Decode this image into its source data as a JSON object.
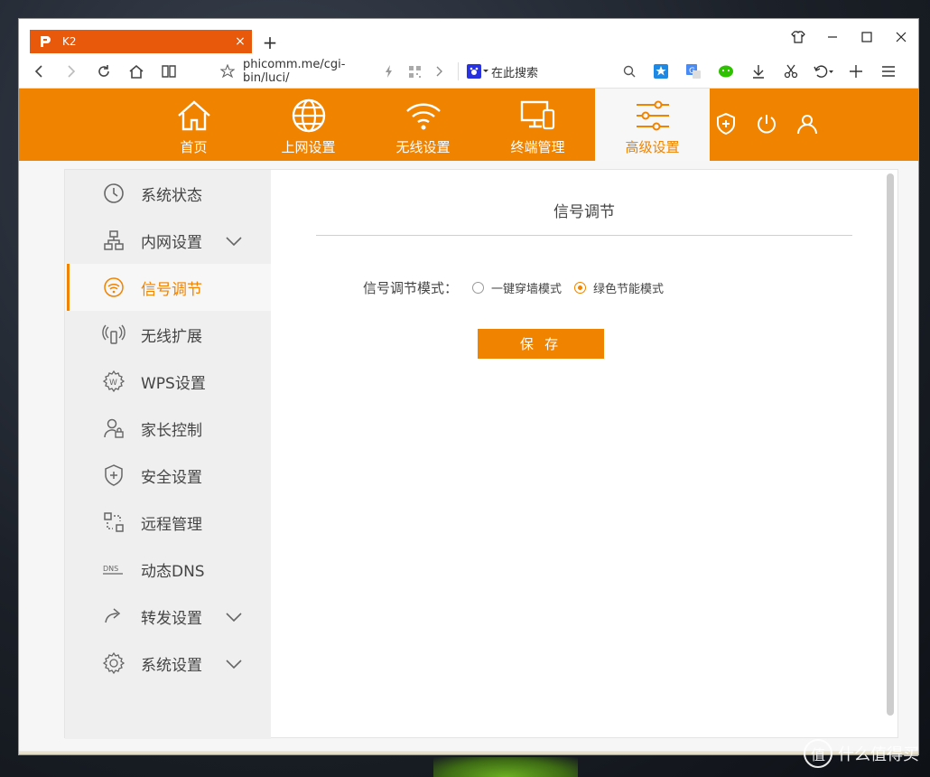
{
  "browser": {
    "tab_title": "K2",
    "tab_logo_letter": "P",
    "tab_close": "×",
    "new_tab": "+",
    "url": "phicomm.me/cgi-bin/luci/",
    "search_placeholder": "在此搜索"
  },
  "router": {
    "nav": [
      {
        "label": "首页",
        "icon": "home-icon"
      },
      {
        "label": "上网设置",
        "icon": "globe-icon"
      },
      {
        "label": "无线设置",
        "icon": "wifi-icon"
      },
      {
        "label": "终端管理",
        "icon": "devices-icon"
      },
      {
        "label": "高级设置",
        "icon": "sliders-icon",
        "active": true
      }
    ],
    "header_icons": [
      "shield-plus-icon",
      "power-icon",
      "user-icon"
    ]
  },
  "sidebar": {
    "items": [
      {
        "label": "系统状态",
        "icon": "clock-icon"
      },
      {
        "label": "内网设置",
        "icon": "network-icon",
        "expandable": true
      },
      {
        "label": "信号调节",
        "icon": "signal-icon",
        "active": true
      },
      {
        "label": "无线扩展",
        "icon": "wireless-extend-icon"
      },
      {
        "label": "WPS设置",
        "icon": "wps-gear-icon"
      },
      {
        "label": "家长控制",
        "icon": "parent-lock-icon"
      },
      {
        "label": "安全设置",
        "icon": "shield-icon"
      },
      {
        "label": "远程管理",
        "icon": "remote-icon"
      },
      {
        "label": "动态DNS",
        "icon": "dns-icon"
      },
      {
        "label": "转发设置",
        "icon": "forward-icon",
        "expandable": true
      },
      {
        "label": "系统设置",
        "icon": "settings-icon",
        "expandable": true
      }
    ]
  },
  "main": {
    "title": "信号调节",
    "mode_label": "信号调节模式：",
    "options": [
      {
        "label": "一键穿墙模式",
        "checked": false
      },
      {
        "label": "绿色节能模式",
        "checked": true
      }
    ],
    "save_label": "保 存"
  },
  "watermark": "什么值得买",
  "colors": {
    "accent": "#f08300",
    "tab": "#e8590c"
  }
}
